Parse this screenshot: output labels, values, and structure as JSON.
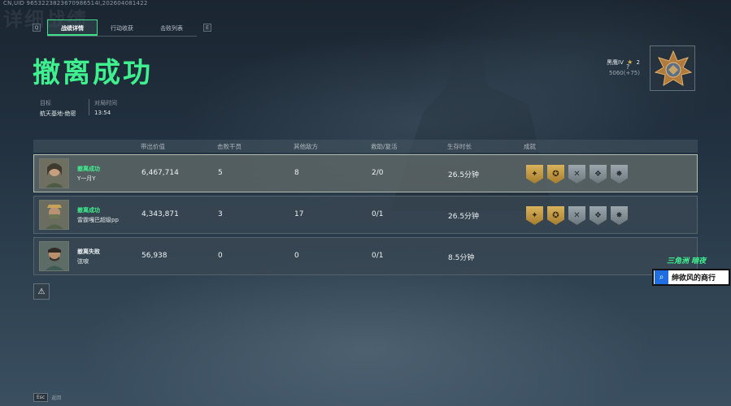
{
  "topline": "CN,UID 9653223823670986514I,202604081422",
  "ghost_title": "详细战绩",
  "tabs": [
    {
      "key_left": "Q"
    },
    {
      "label": "战绩详情"
    },
    {
      "label": "行动收获"
    },
    {
      "label": "击败列表"
    },
    {
      "key_right": "E"
    }
  ],
  "result_title": "撤离成功",
  "meta": {
    "target_label": "目标",
    "target_value": "航天基地-绝密",
    "time_label": "对局时间",
    "time_value": "13:54"
  },
  "rank": {
    "name": "黑鹰IV",
    "stars": "2",
    "points": "5060(+75)",
    "help": "?"
  },
  "table": {
    "headers": [
      "带出价值",
      "击败干员",
      "其他敌方",
      "救助/复活",
      "生存时长",
      "成就"
    ],
    "rows": [
      {
        "status": "撤离成功",
        "player": "Y一月Y",
        "value": "6,467,714",
        "kills": "5",
        "other": "8",
        "rescue": "2/0",
        "time": "26.5分钟"
      },
      {
        "status": "撤离成功",
        "player": "雷霆嘎巴超级pp",
        "value": "4,343,871",
        "kills": "3",
        "other": "17",
        "rescue": "0/1",
        "time": "26.5分钟"
      },
      {
        "status": "撤离失败",
        "player": "弦唳",
        "value": "56,938",
        "kills": "0",
        "other": "0",
        "rescue": "0/1",
        "time": "8.5分钟"
      }
    ]
  },
  "watermark": {
    "line1": "三角洲 暗夜",
    "line2": "绅欲风的商行"
  },
  "footer": {
    "key": "Esc",
    "label": "返回"
  },
  "colors": {
    "accent_green": "#3ff08f",
    "gold_badge": "#d9b25c",
    "silver_badge": "#9ba6ad"
  }
}
